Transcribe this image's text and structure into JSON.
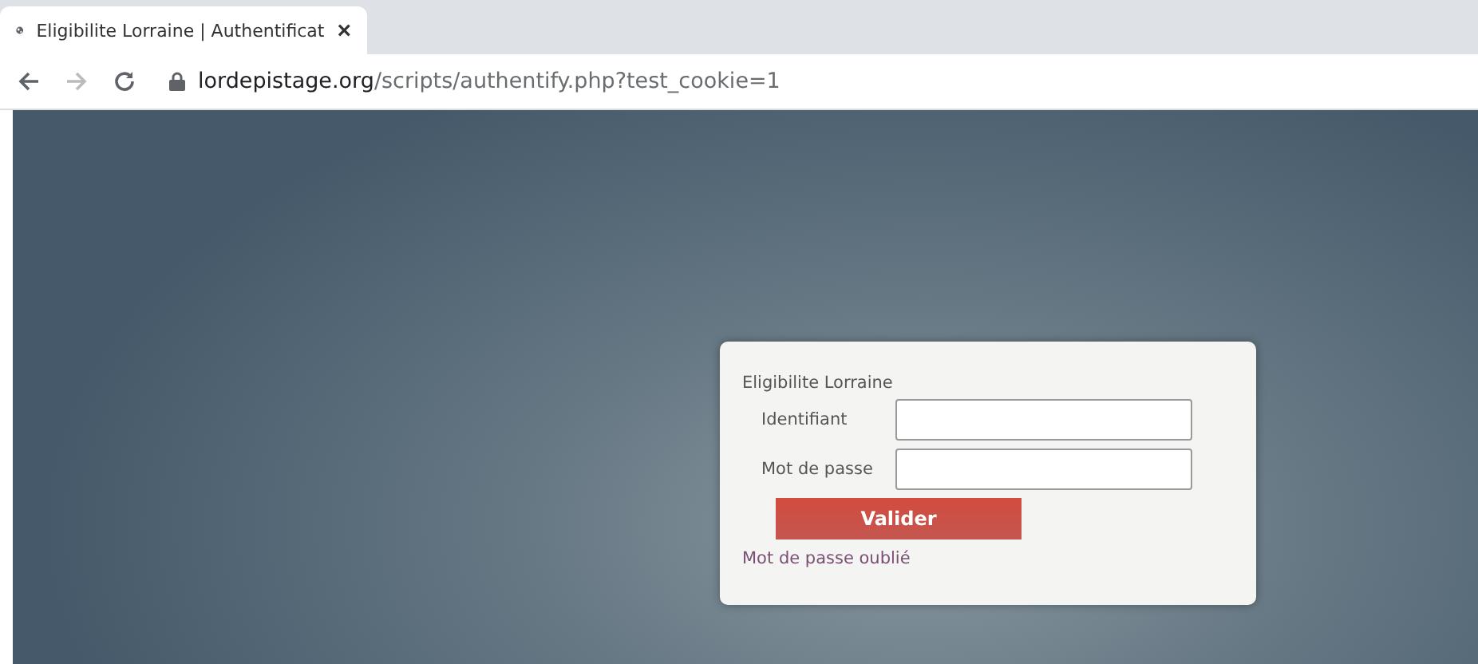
{
  "browser": {
    "tab": {
      "title": "Eligibilite Lorraine | Authentificat",
      "close": "×"
    },
    "url": {
      "domain": "lordepistage.org",
      "path": "/scripts/authentify.php?test_cookie=1"
    }
  },
  "login": {
    "title": "Eligibilite Lorraine",
    "fields": [
      {
        "label": "Identifiant"
      },
      {
        "label": "Mot de passe"
      }
    ],
    "submit": "Valider",
    "forgot_link": "Mot de passe oublié"
  }
}
